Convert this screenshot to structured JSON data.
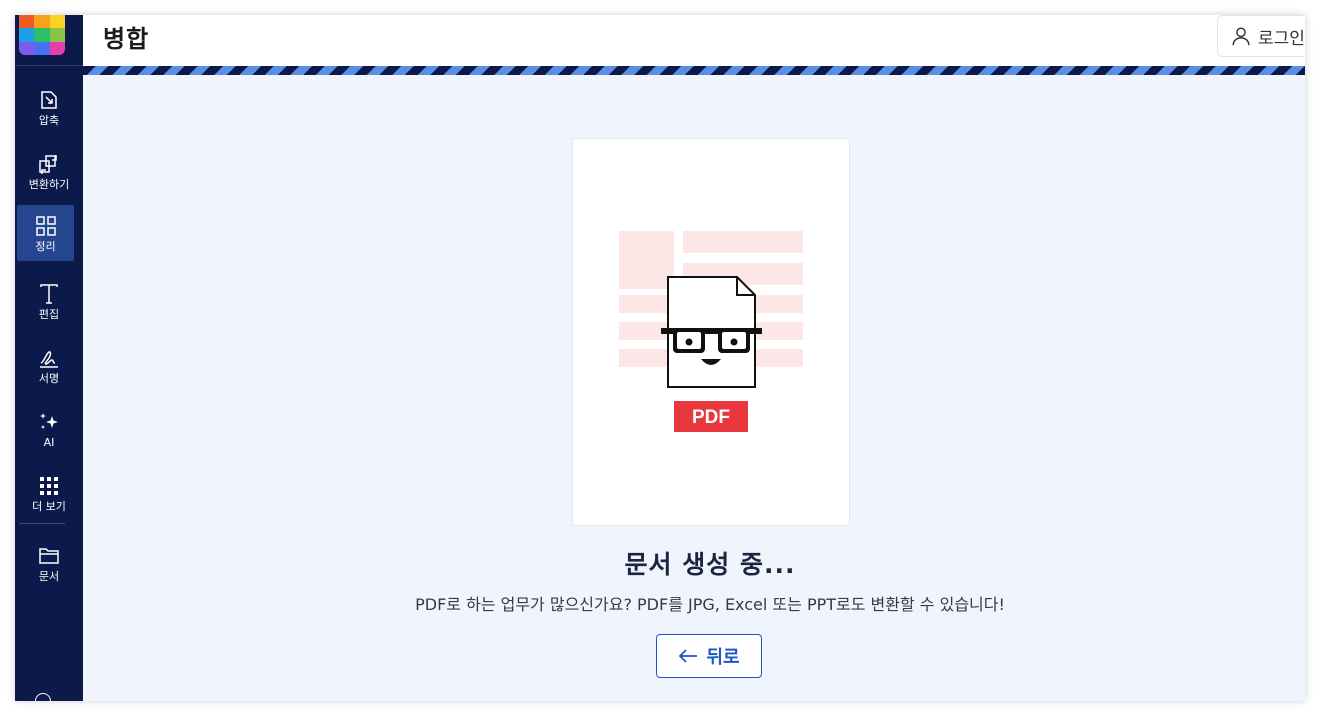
{
  "app": {
    "logo_colors": [
      "#f05a24",
      "#f6a21e",
      "#f9d423",
      "#1ea0e6",
      "#2bbf6a",
      "#8bc34a",
      "#7b5cf0",
      "#4b6ef6",
      "#e83ea8"
    ]
  },
  "sidebar": {
    "items": [
      {
        "label": "압축",
        "icon": "compress-icon"
      },
      {
        "label": "변환하기",
        "icon": "convert-icon"
      },
      {
        "label": "정리",
        "icon": "organize-icon",
        "active": true
      },
      {
        "label": "편집",
        "icon": "edit-text-icon"
      },
      {
        "label": "서명",
        "icon": "sign-icon"
      },
      {
        "label": "AI",
        "icon": "ai-sparkle-icon"
      },
      {
        "label": "더 보기",
        "icon": "more-grid-icon"
      },
      {
        "label": "문서",
        "icon": "folder-icon"
      }
    ]
  },
  "header": {
    "title": "병합",
    "login_label": "로그인"
  },
  "main": {
    "illustration": {
      "badge_text": "PDF",
      "badge_color": "#e8373d",
      "background_block_color": "#fde6e6"
    },
    "status_title": "문서 생성 중...",
    "status_description": "PDF로 하는 업무가 많으신가요? PDF를 JPG, Excel 또는 PPT로도 변환할 수 있습니다!",
    "back_button_label": "뒤로"
  },
  "colors": {
    "sidebar_bg": "#0b1a4a",
    "active_item_bg": "#26458f",
    "main_bg": "#f0f5fd",
    "accent": "#1d56c7"
  }
}
